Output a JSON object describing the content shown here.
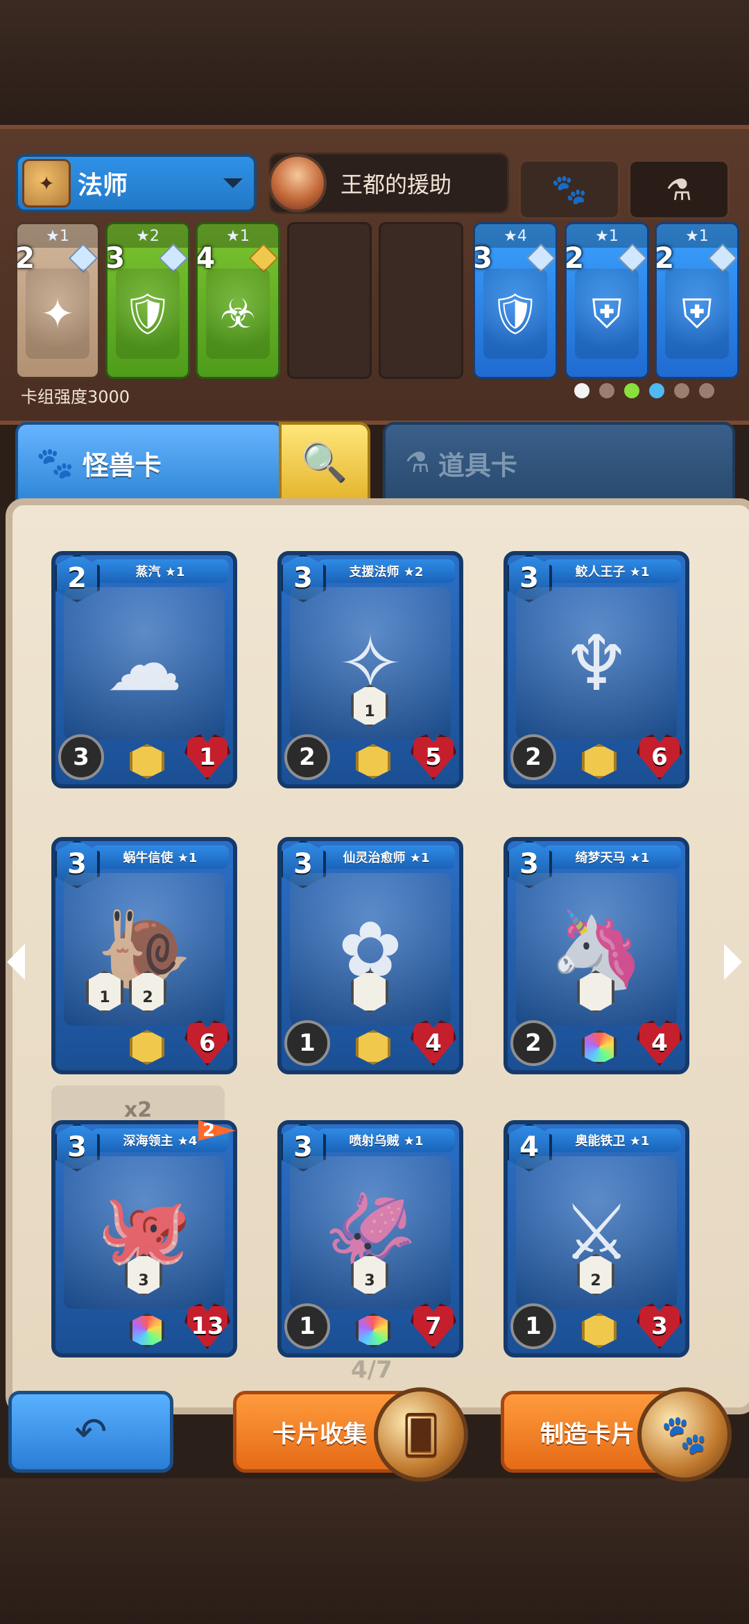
{
  "header": {
    "class_label": "法师",
    "hero_title": "王都的援助"
  },
  "deck": {
    "strength": "卡组强度3000",
    "cards": [
      {
        "stars": "★1",
        "cost": "2",
        "gem": "silver",
        "art": "✦",
        "variant": "gray"
      },
      {
        "stars": "★2",
        "cost": "3",
        "gem": "silver",
        "art": "🛡",
        "variant": "green"
      },
      {
        "stars": "★1",
        "cost": "4",
        "gem": "gold",
        "art": "☣",
        "variant": "green"
      },
      {
        "stars": "★4",
        "cost": "3",
        "gem": "silver",
        "art": "🛡",
        "variant": "blue"
      },
      {
        "stars": "★1",
        "cost": "2",
        "gem": "silver",
        "art": "⛨",
        "variant": "blue"
      },
      {
        "stars": "★1",
        "cost": "2",
        "gem": "silver",
        "art": "⛨",
        "variant": "blue"
      }
    ]
  },
  "tabs": {
    "monster": "怪兽卡",
    "item": "道具卡"
  },
  "collection": {
    "page": "4/7",
    "badge_x2": "x2",
    "flag_count": "2",
    "cards": [
      {
        "name": "蒸汽 ★1",
        "cost": "2",
        "atk": "3",
        "hp": "1",
        "rarity": "gold",
        "art": "☁",
        "skills": []
      },
      {
        "name": "支援法师 ★2",
        "cost": "3",
        "atk": "2",
        "hp": "5",
        "rarity": "gold",
        "art": "✧",
        "skills": [
          "1"
        ]
      },
      {
        "name": "鲛人王子 ★1",
        "cost": "3",
        "atk": "2",
        "hp": "6",
        "rarity": "gold",
        "art": "♆",
        "skills": []
      },
      {
        "name": "蜗牛信使 ★1",
        "cost": "3",
        "atk": "",
        "hp": "6",
        "rarity": "gold",
        "art": "🐌",
        "skills": [
          "1",
          "2"
        ]
      },
      {
        "name": "仙灵治愈师 ★1",
        "cost": "3",
        "atk": "1",
        "hp": "4",
        "rarity": "gold",
        "art": "✿",
        "skills": [
          ""
        ]
      },
      {
        "name": "绮梦天马 ★1",
        "cost": "3",
        "atk": "2",
        "hp": "4",
        "rarity": "rainbow",
        "art": "🦄",
        "skills": [
          ""
        ]
      },
      {
        "name": "深海领主 ★4",
        "cost": "3",
        "atk": "",
        "hp": "13",
        "rarity": "rainbow",
        "art": "🐙",
        "skills": [
          "3"
        ]
      },
      {
        "name": "喷射乌贼 ★1",
        "cost": "3",
        "atk": "1",
        "hp": "7",
        "rarity": "rainbow",
        "art": "🦑",
        "skills": [
          "3"
        ]
      },
      {
        "name": "奥能铁卫 ★1",
        "cost": "4",
        "atk": "1",
        "hp": "3",
        "rarity": "gold",
        "art": "⚔",
        "skills": [
          "2"
        ]
      }
    ]
  },
  "buttons": {
    "back_icon": "↶",
    "collect_label": "卡片收集",
    "craft_label": "制造卡片"
  },
  "colors": {
    "accent_blue": "#2f86d6",
    "accent_orange": "#e56b16"
  }
}
